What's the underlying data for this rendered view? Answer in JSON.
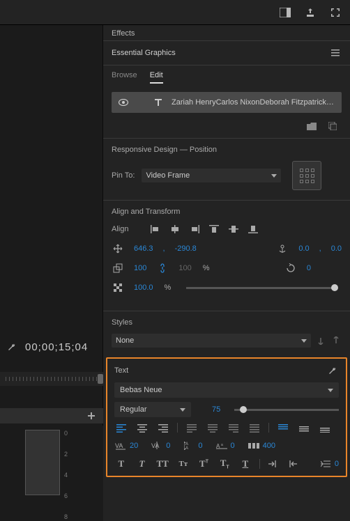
{
  "topbar": {},
  "effects_tab": "Effects",
  "panel_title": "Essential Graphics",
  "subtabs": {
    "browse": "Browse",
    "edit": "Edit"
  },
  "layer": {
    "name": "Zariah HenryCarlos NixonDeborah FitzpatrickBlaz..."
  },
  "responsive": {
    "title": "Responsive Design — Position",
    "pin_label": "Pin To:",
    "pin_value": "Video Frame"
  },
  "align_transform": {
    "title": "Align and Transform",
    "align_label": "Align",
    "pos_x": "646.3",
    "pos_y": "-290.8",
    "anchor_x": "0.0",
    "anchor_y": "0.0",
    "scale_w": "100",
    "scale_h": "100",
    "scale_unit": "%",
    "rotation": "0",
    "opacity": "100.0",
    "opacity_unit": "%"
  },
  "styles": {
    "title": "Styles",
    "value": "None"
  },
  "text": {
    "title": "Text",
    "font": "Bebas Neue",
    "weight": "Regular",
    "size": "75",
    "tracking": "20",
    "kerning": "0",
    "leading": "0",
    "baseline": "0",
    "tsume": "400"
  },
  "timeline": {
    "timecode": "00;00;15;04",
    "ruler": [
      "0",
      "2",
      "4",
      "6",
      "8"
    ]
  }
}
